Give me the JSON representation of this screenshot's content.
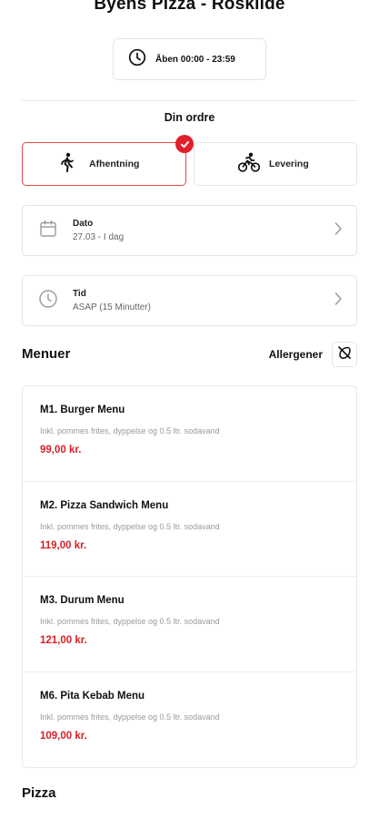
{
  "header": {
    "title": "Byens Pizza - Roskilde"
  },
  "hours": {
    "icon": "clock-icon",
    "text": "Åben 00:00 - 23:59"
  },
  "order": {
    "title": "Din ordre",
    "modes": [
      {
        "label": "Afhentning",
        "icon": "walking-person-icon",
        "selected": true
      },
      {
        "label": "Levering",
        "icon": "cyclist-icon",
        "selected": false
      }
    ],
    "accent_color": "#e0202a"
  },
  "date": {
    "label": "Dato",
    "value": "27.03 - I dag",
    "icon": "calendar-icon"
  },
  "time": {
    "label": "Tid",
    "value": "ASAP (15 Minutter)",
    "icon": "clock-icon"
  },
  "menus": {
    "heading": "Menuer",
    "allergen_label": "Allergener",
    "allergen_icon": "allergen-icon",
    "items": [
      {
        "name": "M1. Burger Menu",
        "description": "Inkl. pommes frites, dyppelse og 0.5 ltr. sodavand",
        "price": "99,00 kr."
      },
      {
        "name": "M2. Pizza Sandwich Menu",
        "description": "Inkl. pommes frites, dyppelse og 0.5 ltr. sodavand",
        "price": "119,00 kr."
      },
      {
        "name": "M3. Durum Menu",
        "description": "Inkl. pommes frites, dyppelse og 0.5 ltr. sodavand",
        "price": "121,00 kr."
      },
      {
        "name": "M6. Pita Kebab Menu",
        "description": "Inkl. pommes frites, dyppelse og 0.5 ltr. sodavand",
        "price": "109,00 kr."
      }
    ],
    "price_color": "#d81f26"
  },
  "pizza": {
    "heading": "Pizza"
  }
}
